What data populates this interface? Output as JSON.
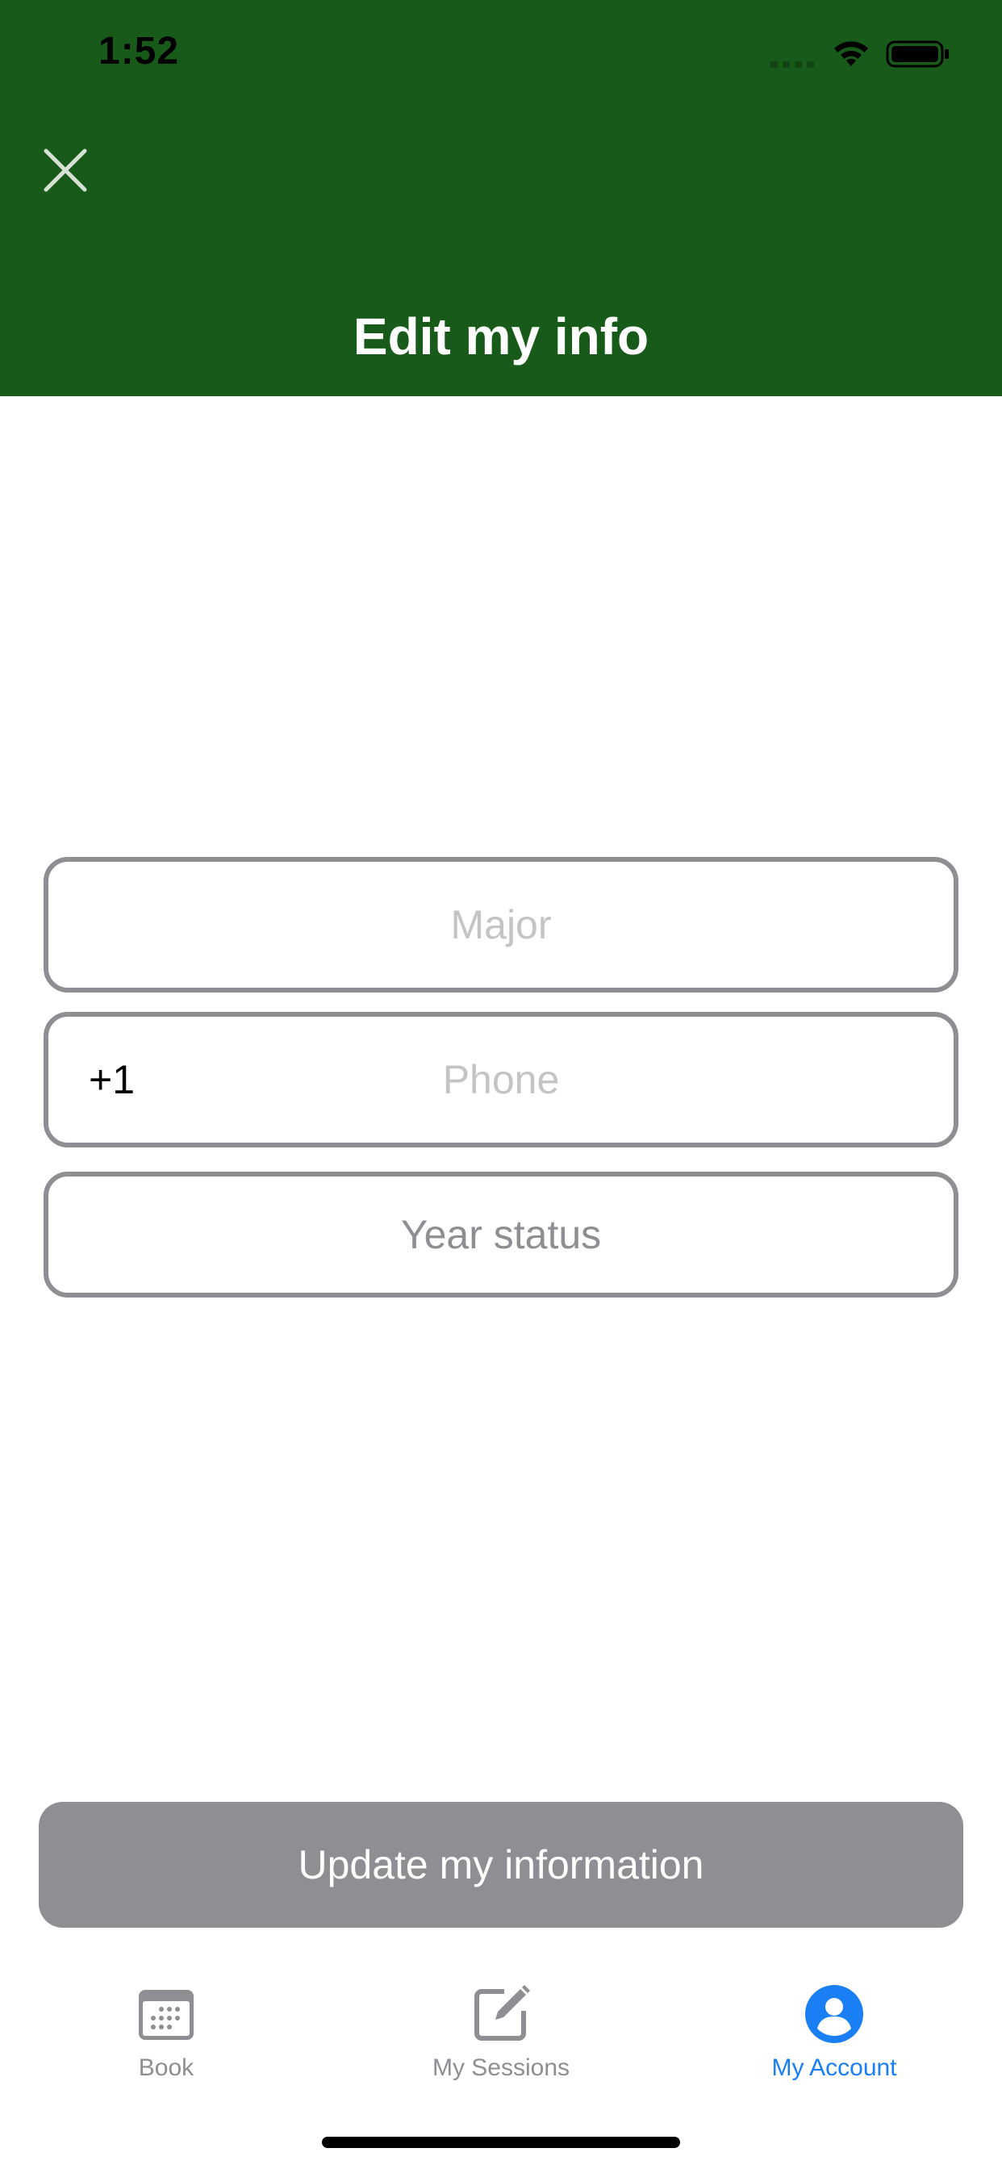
{
  "status_bar": {
    "time": "1:52",
    "icons": [
      "cellular-signal-icon",
      "wifi-icon",
      "battery-icon"
    ]
  },
  "header": {
    "close_icon": "close-icon",
    "title": "Edit my info",
    "background_color": "#185a19"
  },
  "form": {
    "major": {
      "value": "",
      "placeholder": "Major"
    },
    "phone": {
      "prefix": "+1",
      "value": "",
      "placeholder": "Phone"
    },
    "year_status": {
      "label": "Year status"
    }
  },
  "update_button": {
    "label": "Update my information",
    "color": "#8e8e93"
  },
  "tab_bar": {
    "tabs": [
      {
        "label": "Book",
        "icon": "calendar-icon",
        "active": false
      },
      {
        "label": "My Sessions",
        "icon": "edit-note-icon",
        "active": false
      },
      {
        "label": "My Account",
        "icon": "account-icon",
        "active": true
      }
    ],
    "active_color": "#1a7ef5",
    "inactive_color": "#8e8e93"
  }
}
